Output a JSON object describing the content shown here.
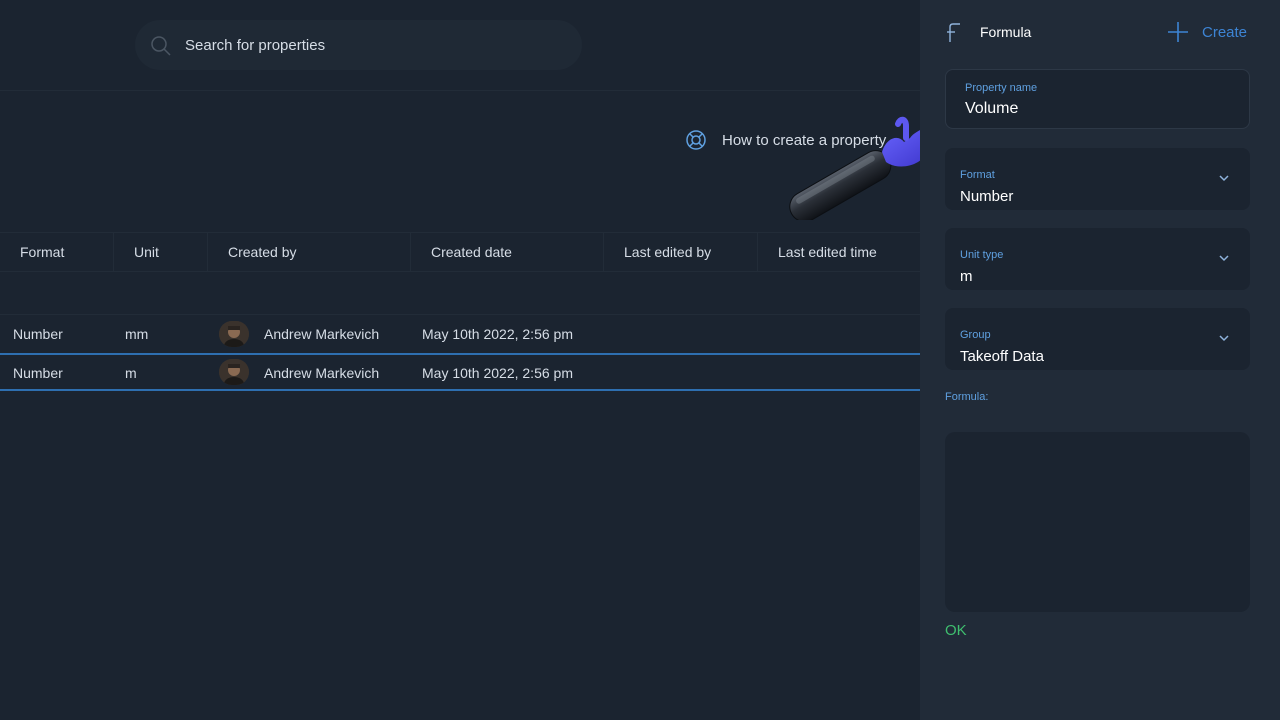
{
  "search": {
    "placeholder": "Search for properties"
  },
  "help": {
    "label": "How to create a property"
  },
  "table": {
    "columns": [
      "Format",
      "Unit",
      "Created by",
      "Created date",
      "Last edited by",
      "Last edited time"
    ],
    "rows": [
      {
        "format": "Number",
        "unit": "mm",
        "created_by": "Andrew Markevich",
        "created_date": "May 10th 2022, 2:56 pm",
        "last_edited_by": "",
        "last_edited_time": ""
      },
      {
        "format": "Number",
        "unit": "m",
        "created_by": "Andrew Markevich",
        "created_date": "May 10th 2022, 2:56 pm",
        "last_edited_by": "",
        "last_edited_time": ""
      }
    ]
  },
  "panel": {
    "title": "Formula",
    "create_label": "Create",
    "property_name": {
      "label": "Property name",
      "value": "Volume"
    },
    "format": {
      "label": "Format",
      "value": "Number"
    },
    "unit_type": {
      "label": "Unit type",
      "value": "m"
    },
    "group": {
      "label": "Group",
      "value": "Takeoff Data"
    },
    "formula_label": "Formula:",
    "formula_value": "",
    "ok_label": "OK"
  },
  "colors": {
    "accent": "#3d84d4",
    "ok": "#3fbf6f",
    "selection": "#2e6fb0",
    "panel_bg": "#212b38",
    "main_bg": "#1b2430"
  },
  "icons": [
    "search-icon",
    "lifebuoy-icon",
    "formula-icon",
    "plus-icon",
    "chevron-down-icon",
    "hand-pointer-icon"
  ]
}
